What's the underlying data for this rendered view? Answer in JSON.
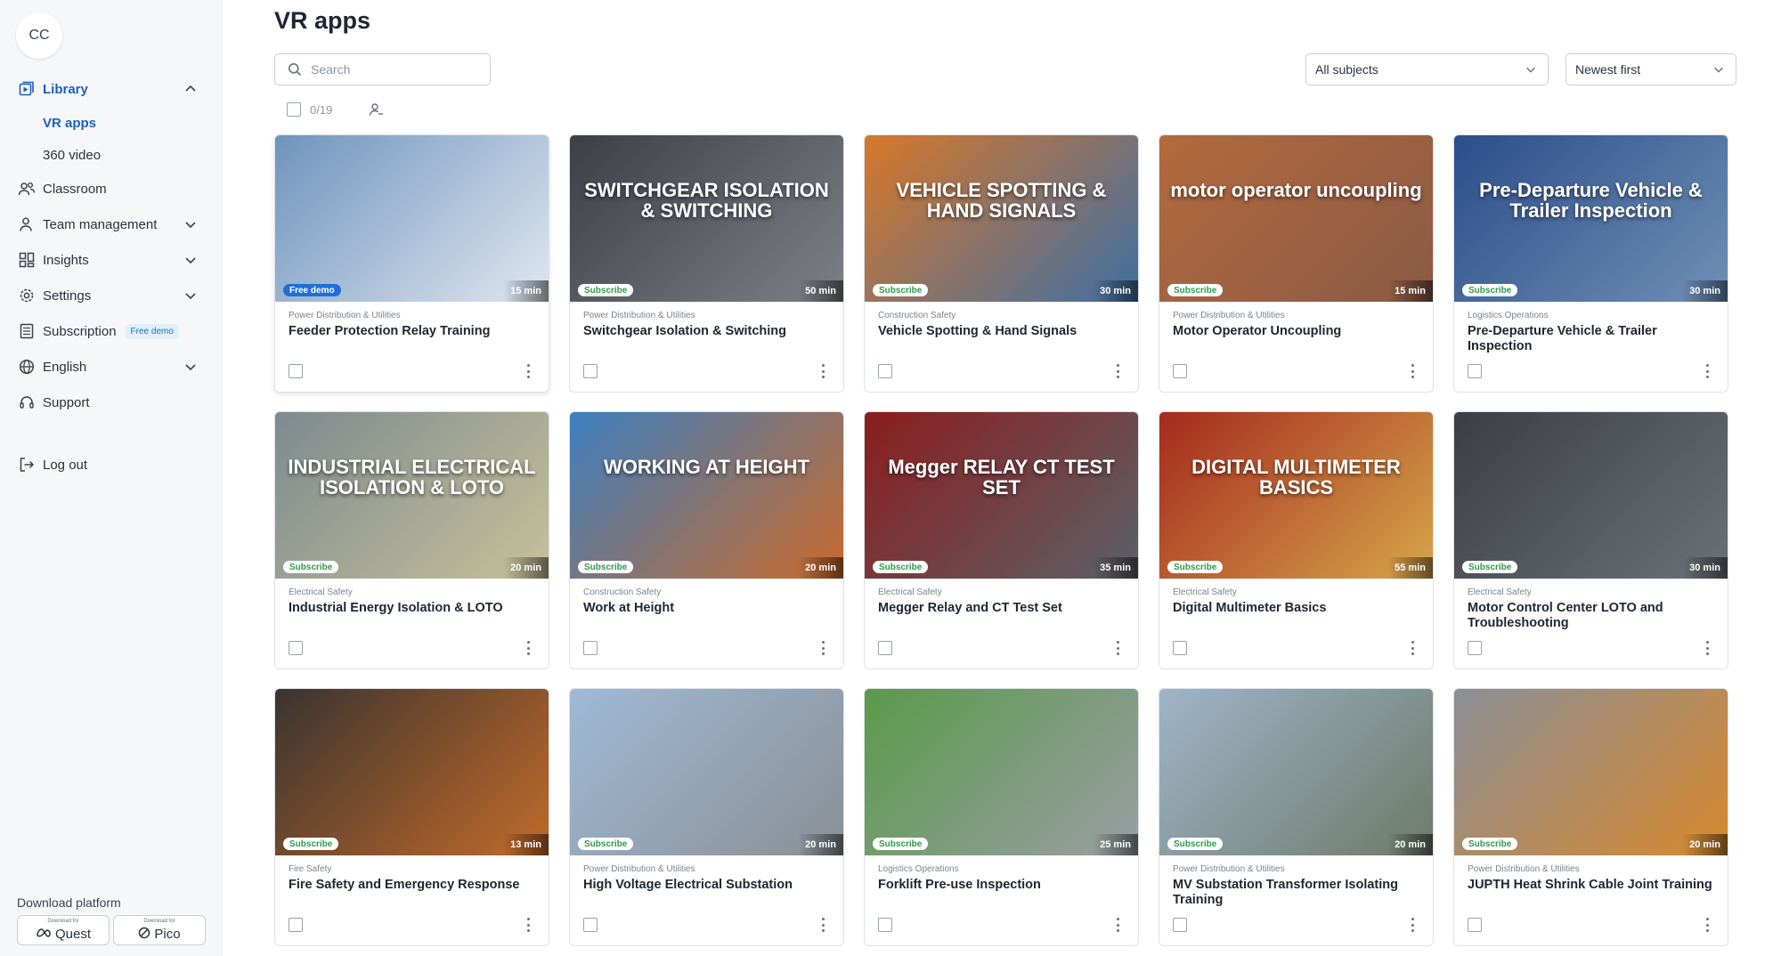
{
  "user": {
    "initials": "CC"
  },
  "sidebar": {
    "library": "Library",
    "library_sub": [
      "VR apps",
      "360 video"
    ],
    "items": [
      {
        "label": "Classroom"
      },
      {
        "label": "Team management"
      },
      {
        "label": "Insights"
      },
      {
        "label": "Settings"
      },
      {
        "label": "Subscription",
        "badge": "Free demo"
      },
      {
        "label": "English"
      },
      {
        "label": "Support"
      }
    ],
    "logout": "Log out",
    "download": {
      "label": "Download platform",
      "quest_small": "Download for",
      "quest": "Quest",
      "pico_small": "Download for",
      "pico": "Pico"
    }
  },
  "main": {
    "title": "VR apps",
    "search_placeholder": "Search",
    "subject_filter": "All subjects",
    "sort": "Newest first",
    "selection_count": "0/19"
  },
  "colors": {
    "accent": "#1f5fbf",
    "subscribe": "#2f9a4a",
    "demo": "#1f6fd6"
  },
  "apps": [
    {
      "category": "Power Distribution & Utilities",
      "title": "Feeder Protection Relay Training",
      "duration": "15 min",
      "access": "Free demo",
      "thumb_text": "",
      "thumb_colors": [
        "#6f93bd",
        "#dfe7f0"
      ]
    },
    {
      "category": "Power Distribution & Utilities",
      "title": "Switchgear Isolation & Switching",
      "duration": "50 min",
      "access": "Subscribe",
      "thumb_text": "SWITCHGEAR ISOLATION & SWITCHING",
      "thumb_colors": [
        "#3c4046",
        "#7d8086"
      ]
    },
    {
      "category": "Construction Safety",
      "title": "Vehicle Spotting & Hand Signals",
      "duration": "30 min",
      "access": "Subscribe",
      "thumb_text": "VEHICLE SPOTTING & HAND SIGNALS",
      "thumb_colors": [
        "#d8772a",
        "#3f6fa3"
      ]
    },
    {
      "category": "Power Distribution & Utilities",
      "title": "Motor Operator Uncoupling",
      "duration": "15 min",
      "access": "Subscribe",
      "thumb_text": "motor operator uncoupling",
      "thumb_colors": [
        "#b36a3d",
        "#8a5a45"
      ]
    },
    {
      "category": "Logistics Operations",
      "title": "Pre-Departure Vehicle & Trailer Inspection",
      "duration": "30 min",
      "access": "Subscribe",
      "thumb_text": "Pre-Departure Vehicle & Trailer Inspection",
      "thumb_colors": [
        "#2c4e8a",
        "#6f8fb5"
      ]
    },
    {
      "category": "Electrical Safety",
      "title": "Industrial Energy Isolation & LOTO",
      "duration": "20 min",
      "access": "Subscribe",
      "thumb_text": "INDUSTRIAL ELECTRICAL ISOLATION & LOTO",
      "thumb_colors": [
        "#7e8a8f",
        "#c7c19a"
      ]
    },
    {
      "category": "Construction Safety",
      "title": "Work at Height",
      "duration": "20 min",
      "access": "Subscribe",
      "thumb_text": "WORKING AT HEIGHT",
      "thumb_colors": [
        "#3d7fc0",
        "#c96a2b"
      ]
    },
    {
      "category": "Electrical Safety",
      "title": "Megger Relay and CT Test Set",
      "duration": "35 min",
      "access": "Subscribe",
      "thumb_text": "Megger RELAY CT TEST SET",
      "thumb_colors": [
        "#8b1d1d",
        "#5b6168"
      ]
    },
    {
      "category": "Electrical Safety",
      "title": "Digital Multimeter Basics",
      "duration": "55 min",
      "access": "Subscribe",
      "thumb_text": "DIGITAL MULTIMETER BASICS",
      "thumb_colors": [
        "#a52a1e",
        "#d6a54a"
      ]
    },
    {
      "category": "Electrical Safety",
      "title": "Motor Control Center LOTO and Troubleshooting",
      "duration": "30 min",
      "access": "Subscribe",
      "thumb_text": "",
      "thumb_colors": [
        "#3b3e44",
        "#6c7078"
      ]
    },
    {
      "category": "Fire Safety",
      "title": "Fire Safety and Emergency Response",
      "duration": "13 min",
      "access": "Subscribe",
      "thumb_text": "",
      "thumb_colors": [
        "#3a3430",
        "#c26a2a"
      ]
    },
    {
      "category": "Power Distribution & Utilities",
      "title": "High Voltage Electrical Substation",
      "duration": "20 min",
      "access": "Subscribe",
      "thumb_text": "",
      "thumb_colors": [
        "#9fbad6",
        "#8a8f95"
      ]
    },
    {
      "category": "Logistics Operations",
      "title": "Forklift Pre-use Inspection",
      "duration": "25 min",
      "access": "Subscribe",
      "thumb_text": "",
      "thumb_colors": [
        "#5a9a4a",
        "#9a9ea4"
      ]
    },
    {
      "category": "Power Distribution & Utilities",
      "title": "MV Substation Transformer Isolating Training",
      "duration": "20 min",
      "access": "Subscribe",
      "thumb_text": "",
      "thumb_colors": [
        "#9fb4c8",
        "#6d7b6a"
      ]
    },
    {
      "category": "Power Distribution & Utilities",
      "title": "JUPTH Heat Shrink Cable Joint Training",
      "duration": "20 min",
      "access": "Subscribe",
      "thumb_text": "",
      "thumb_colors": [
        "#8a8f96",
        "#d8882e"
      ]
    }
  ]
}
